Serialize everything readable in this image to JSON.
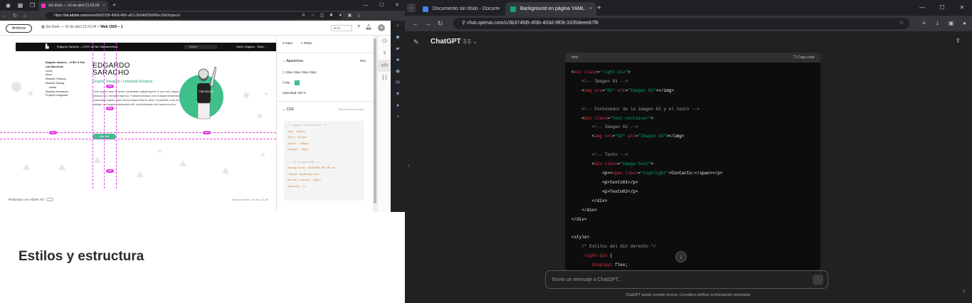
{
  "left_browser": {
    "tab_title": "Sin título — 16 de abril 21.53.04",
    "url_prefix": "https://",
    "url_host": "xd.adobe.com",
    "url_path": "/view/6b021f3f-490d-46fc-af11-0b54665b945e-93e3/specs/"
  },
  "xd": {
    "archive_button": "Archivos",
    "breadcrumb_doc": "Sin título — 16 de abril 21.53.04",
    "breadcrumb_sep": ">",
    "breadcrumb_page": "Web 1920 – 1",
    "zoom": "50 %",
    "footer_left": "Realizado con Adobe XD",
    "footer_right": "Nuevo versión: 16 abr. 21:53"
  },
  "artboard": {
    "header_title": "Edgardo Saracho – LTIEC & Fab Lab Barcelona",
    "search_placeholder": "Search",
    "header_right": "Home | Edgardo... Sobre...",
    "side_title": "Edgardo Saracho – LTIEC & Fab Lab Barcelona",
    "side_items": [
      "Home",
      "About",
      "Modules Técnicos",
      "Modules Display",
      "Adobe",
      "Modules Innovación",
      "Proyecto Integrador"
    ],
    "name_line1": "EDGARDO",
    "name_line2": "SARACHO",
    "role": "Graphic Designer | Industrial Designer",
    "body": "Lorem ipsum dolor sit amet, consectetur adipiscing elit. In sem orci, aliquet vitae vehicula nec, hendrerit eget dui. Praesent tristique, est id aliquet fermentum, nisi mi consectetur sapien, vitae viverra sapien felis eu dolor. In pharetra, urna non egestas tristique, est magna malesuada velit, a pellentesque nisi mauris ac arcu.",
    "button": "View Me",
    "shirt_text": "FAB EDGAR",
    "pill_labels": [
      "163",
      "164",
      "163",
      "162",
      "163"
    ]
  },
  "inspector": {
    "x_label": "X",
    "x_value": "53px",
    "y_label": "Y",
    "y_value": "400px",
    "appearance": "Apariencia",
    "appearance_extra": "Rés",
    "radius_values": "26px  26px  26px  26px",
    "color_label": "Color",
    "opacity_label": "Opacidad",
    "opacity_value": "100 %",
    "css_label": "CSS",
    "css_action": "Seleccionar para copiar",
    "code_lines": [
      "/* Layout Properties */",
      "top: 410px;",
      "left: 517px;",
      "width: 100px;",
      "height: 53px;",
      "",
      "/* UI Properties */",
      "background: #3DC080 0% 0% no-",
      "repeat padding-box;",
      "border-radius: 26px;",
      "opacity: 1;"
    ]
  },
  "heading": "Estilos y estructura",
  "right_browser": {
    "tab1": "Documento sin título - Docum",
    "tab2": "Background en página YAML.",
    "url": "chat.openai.com/c/3b374fd5-4f3b-403d-9f08-3335deeeb7f8"
  },
  "chatgpt": {
    "model": "ChatGPT",
    "version": "3.5",
    "code_lang": "html",
    "copy_label": "Copy code",
    "input_placeholder": "Envía un mensaje a ChatGPT...",
    "disclaimer": "ChatGPT puede cometer errores. Considera verificar la información importante.",
    "help": "?"
  },
  "colors": {
    "accent_green": "#3fc08a",
    "guide_magenta": "#e040e0",
    "code_tag": "#f22c3d",
    "code_string": "#00a67d"
  }
}
